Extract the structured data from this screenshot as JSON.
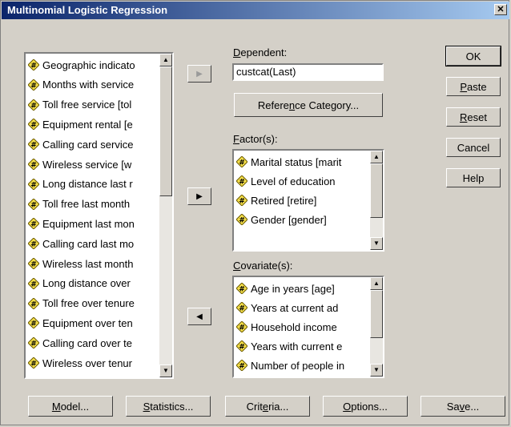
{
  "window": {
    "title": "Multinomial Logistic Regression",
    "close_glyph": "✕"
  },
  "variables_list": [
    "Geographic indicato",
    "Months with service",
    "Toll free service [tol",
    "Equipment rental [e",
    "Calling card service",
    "Wireless service [w",
    "Long distance last r",
    "Toll free last month",
    "Equipment last mon",
    "Calling card last mo",
    "Wireless last month",
    "Long distance over",
    "Toll free over tenure",
    "Equipment over ten",
    "Calling card over te",
    "Wireless over tenur"
  ],
  "dependent": {
    "label_u": "D",
    "label_rest": "ependent:",
    "value": "custcat(Last)"
  },
  "reference_button": {
    "pre": "Refere",
    "u": "n",
    "post": "ce Category..."
  },
  "factors": {
    "label_u": "F",
    "label_rest": "actor(s):",
    "items": [
      "Marital status [marit",
      "Level of education",
      "Retired [retire]",
      "Gender [gender]"
    ]
  },
  "covariates": {
    "label_u": "C",
    "label_rest": "ovariate(s):",
    "items": [
      "Age in years [age]",
      "Years at current ad",
      "Household income",
      "Years with current e",
      "Number of people in"
    ]
  },
  "side_buttons": {
    "ok": "OK",
    "paste_u": "P",
    "paste_rest": "aste",
    "reset_u": "R",
    "reset_rest": "eset",
    "cancel": "Cancel",
    "help": "Help"
  },
  "bottom_buttons": {
    "model_u": "M",
    "model_rest": "odel...",
    "statistics_u": "S",
    "statistics_rest": "tatistics...",
    "criteria_pre": "Crit",
    "criteria_u": "e",
    "criteria_post": "ria...",
    "options_u": "O",
    "options_rest": "ptions...",
    "save_pre": "Sa",
    "save_u": "v",
    "save_post": "e..."
  },
  "icons": {
    "variable": "scale-variable-icon",
    "arrow_right": "▶",
    "arrow_left": "◀",
    "scroll_up": "▲",
    "scroll_down": "▼"
  },
  "colors": {
    "titlebar_start": "#0a246a",
    "titlebar_end": "#a6caf0",
    "dialog_bg": "#d4d0c8",
    "icon_yellow": "#f6e04a"
  }
}
